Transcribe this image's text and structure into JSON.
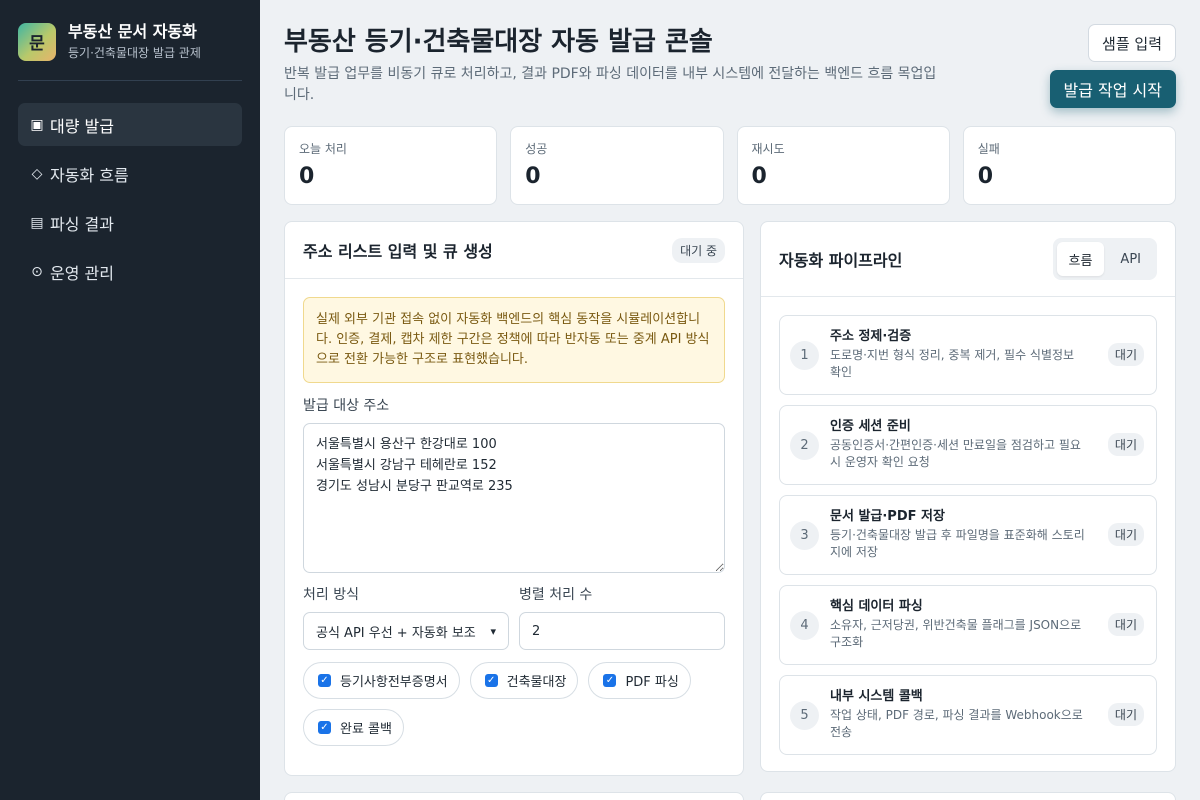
{
  "sidebar": {
    "logo_char": "문",
    "title": "부동산 문서 자동화",
    "subtitle": "등기·건축물대장 발급 관제",
    "items": [
      {
        "icon": "▣",
        "label": "대량 발급"
      },
      {
        "icon": "◇",
        "label": "자동화 흐름"
      },
      {
        "icon": "▤",
        "label": "파싱 결과"
      },
      {
        "icon": "⊙",
        "label": "운영 관리"
      }
    ]
  },
  "header": {
    "title": "부동산 등기·건축물대장 자동 발급 콘솔",
    "description": "반복 발급 업무를 비동기 큐로 처리하고, 결과 PDF와 파싱 데이터를 내부 시스템에 전달하는 백엔드 흐름 목업입니다.",
    "sample_button": "샘플 입력",
    "start_button": "발급 작업 시작"
  },
  "stats": [
    {
      "label": "오늘 처리",
      "value": "0"
    },
    {
      "label": "성공",
      "value": "0"
    },
    {
      "label": "재시도",
      "value": "0"
    },
    {
      "label": "실패",
      "value": "0"
    }
  ],
  "input_panel": {
    "title": "주소 리스트 입력 및 큐 생성",
    "status": "대기 중",
    "notice": "실제 외부 기관 접속 없이 자동화 백엔드의 핵심 동작을 시뮬레이션합니다. 인증, 결제, 캡차 제한 구간은 정책에 따라 반자동 또는 중계 API 방식으로 전환 가능한 구조로 표현했습니다.",
    "address_label": "발급 대상 주소",
    "addresses": "서울특별시 용산구 한강대로 100\n서울특별시 강남구 테헤란로 152\n경기도 성남시 분당구 판교역로 235",
    "mode_label": "처리 방식",
    "mode_value": "공식 API 우선 + 자동화 보조",
    "parallel_label": "병렬 처리 수",
    "parallel_value": "2",
    "options": [
      {
        "label": "등기사항전부증명서",
        "checked": true
      },
      {
        "label": "건축물대장",
        "checked": true
      },
      {
        "label": "PDF 파싱",
        "checked": true
      },
      {
        "label": "완료 콜백",
        "checked": true
      }
    ]
  },
  "pipeline_panel": {
    "title": "자동화 파이프라인",
    "tabs": [
      "흐름",
      "API"
    ],
    "steps": [
      {
        "num": "1",
        "title": "주소 정제·검증",
        "desc": "도로명·지번 형식 정리, 중복 제거, 필수 식별정보 확인",
        "status": "대기"
      },
      {
        "num": "2",
        "title": "인증 세션 준비",
        "desc": "공동인증서·간편인증·세션 만료일을 점검하고 필요 시 운영자 확인 요청",
        "status": "대기"
      },
      {
        "num": "3",
        "title": "문서 발급·PDF 저장",
        "desc": "등기·건축물대장 발급 후 파일명을 표준화해 스토리지에 저장",
        "status": "대기"
      },
      {
        "num": "4",
        "title": "핵심 데이터 파싱",
        "desc": "소유자, 근저당권, 위반건축물 플래그를 JSON으로 구조화",
        "status": "대기"
      },
      {
        "num": "5",
        "title": "내부 시스템 콜백",
        "desc": "작업 상태, PDF 경로, 파싱 결과를 Webhook으로 전송",
        "status": "대기"
      }
    ]
  },
  "colors": {
    "sidebar_bg": "#1b242e",
    "primary": "#185f72",
    "notice_bg": "#fff8e2"
  }
}
